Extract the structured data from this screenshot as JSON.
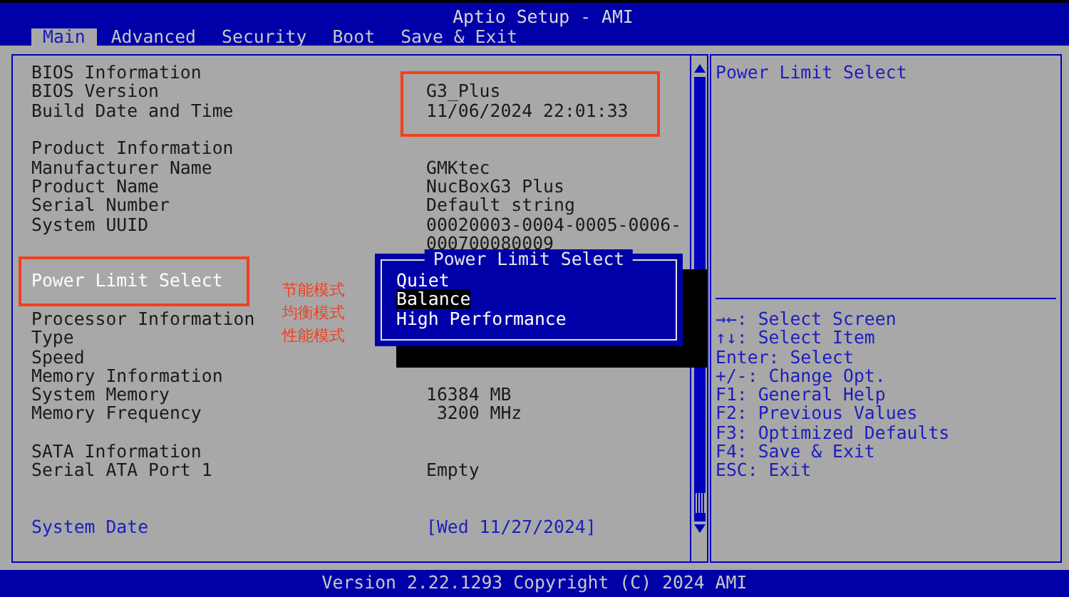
{
  "window": {
    "title": "Aptio Setup - AMI"
  },
  "tabs": [
    {
      "label": "Main",
      "selected": true
    },
    {
      "label": "Advanced",
      "selected": false
    },
    {
      "label": "Security",
      "selected": false
    },
    {
      "label": "Boot",
      "selected": false
    },
    {
      "label": "Save & Exit",
      "selected": false
    }
  ],
  "rows": [
    {
      "kind": "info",
      "label": "BIOS Information"
    },
    {
      "kind": "info",
      "label": "BIOS Version",
      "value": "G3_Plus"
    },
    {
      "kind": "info",
      "label": "Build Date and Time",
      "value": "11/06/2024 22:01:33"
    },
    {
      "kind": "blank"
    },
    {
      "kind": "info",
      "label": "Product Information"
    },
    {
      "kind": "info",
      "label": "Manufacturer Name",
      "value": "GMKtec"
    },
    {
      "kind": "info",
      "label": "Product Name",
      "value": "NucBoxG3 Plus"
    },
    {
      "kind": "info",
      "label": "Serial Number",
      "value": "Default string"
    },
    {
      "kind": "info",
      "label": "System UUID",
      "value": "00020003-0004-0005-0006-"
    },
    {
      "kind": "info",
      "value": "000700080009"
    },
    {
      "kind": "blank"
    },
    {
      "kind": "option",
      "label": "Power Limit Select",
      "selected": true
    },
    {
      "kind": "blank"
    },
    {
      "kind": "info",
      "label": "Processor Information"
    },
    {
      "kind": "info",
      "label": "Type"
    },
    {
      "kind": "info",
      "label": "Speed"
    },
    {
      "kind": "info",
      "label": "Memory Information"
    },
    {
      "kind": "info",
      "label": "System Memory",
      "value": "16384 MB"
    },
    {
      "kind": "info",
      "label": "Memory Frequency",
      "value": " 3200 MHz"
    },
    {
      "kind": "blank"
    },
    {
      "kind": "info",
      "label": "SATA Information"
    },
    {
      "kind": "info",
      "label": "Serial ATA Port 1",
      "value": "Empty"
    },
    {
      "kind": "blank"
    },
    {
      "kind": "blank"
    },
    {
      "kind": "option",
      "label": "System Date",
      "value": "[Wed 11/27/2024]",
      "selected": false
    }
  ],
  "popup": {
    "title": "Power Limit Select",
    "options": [
      {
        "label": "Quiet",
        "selected": false
      },
      {
        "label": "Balance",
        "selected": true
      },
      {
        "label": "High Performance",
        "selected": false
      }
    ]
  },
  "annotations": [
    "节能模式",
    "均衡模式",
    "性能模式"
  ],
  "help": {
    "title": "Power Limit Select",
    "keys": [
      "→←: Select Screen",
      "↑↓: Select Item",
      "Enter: Select",
      "+/-: Change Opt.",
      "F1: General Help",
      "F2: Previous Values",
      "F3: Optimized Defaults",
      "F4: Save & Exit",
      "ESC: Exit"
    ]
  },
  "status_bar": "Version 2.22.1293 Copyright (C) 2024 AMI"
}
